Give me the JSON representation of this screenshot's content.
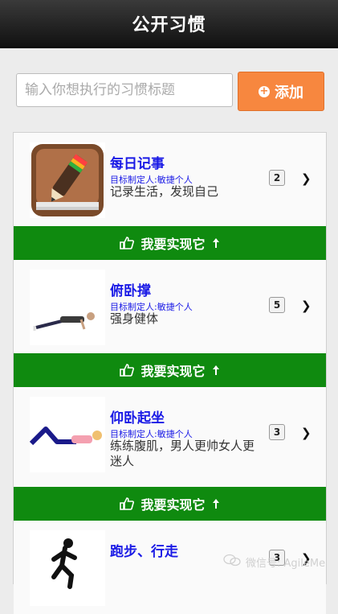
{
  "header": {
    "title": "公开习惯"
  },
  "search": {
    "placeholder": "输入你想执行的习惯标题"
  },
  "add_button": {
    "label": "添加"
  },
  "goal_button_label": "我要实现它",
  "habits": [
    {
      "title": "每日记事",
      "owner": "目标制定人:敏捷个人",
      "description": "记录生活，发现自己",
      "count": "2"
    },
    {
      "title": "俯卧撑",
      "owner": "目标制定人:敏捷个人",
      "description": "强身健体",
      "count": "5"
    },
    {
      "title": "仰卧起坐",
      "owner": "目标制定人:敏捷个人",
      "description": "练练腹肌，男人更帅女人更迷人",
      "count": "3"
    },
    {
      "title": "跑步、行走",
      "owner": "",
      "description": "",
      "count": "3"
    }
  ],
  "watermark": {
    "text": "微信号: AgileMe"
  },
  "colors": {
    "accent": "#f7873f",
    "goal_green": "#0f8a0f",
    "title_blue": "#1a1ae6"
  }
}
